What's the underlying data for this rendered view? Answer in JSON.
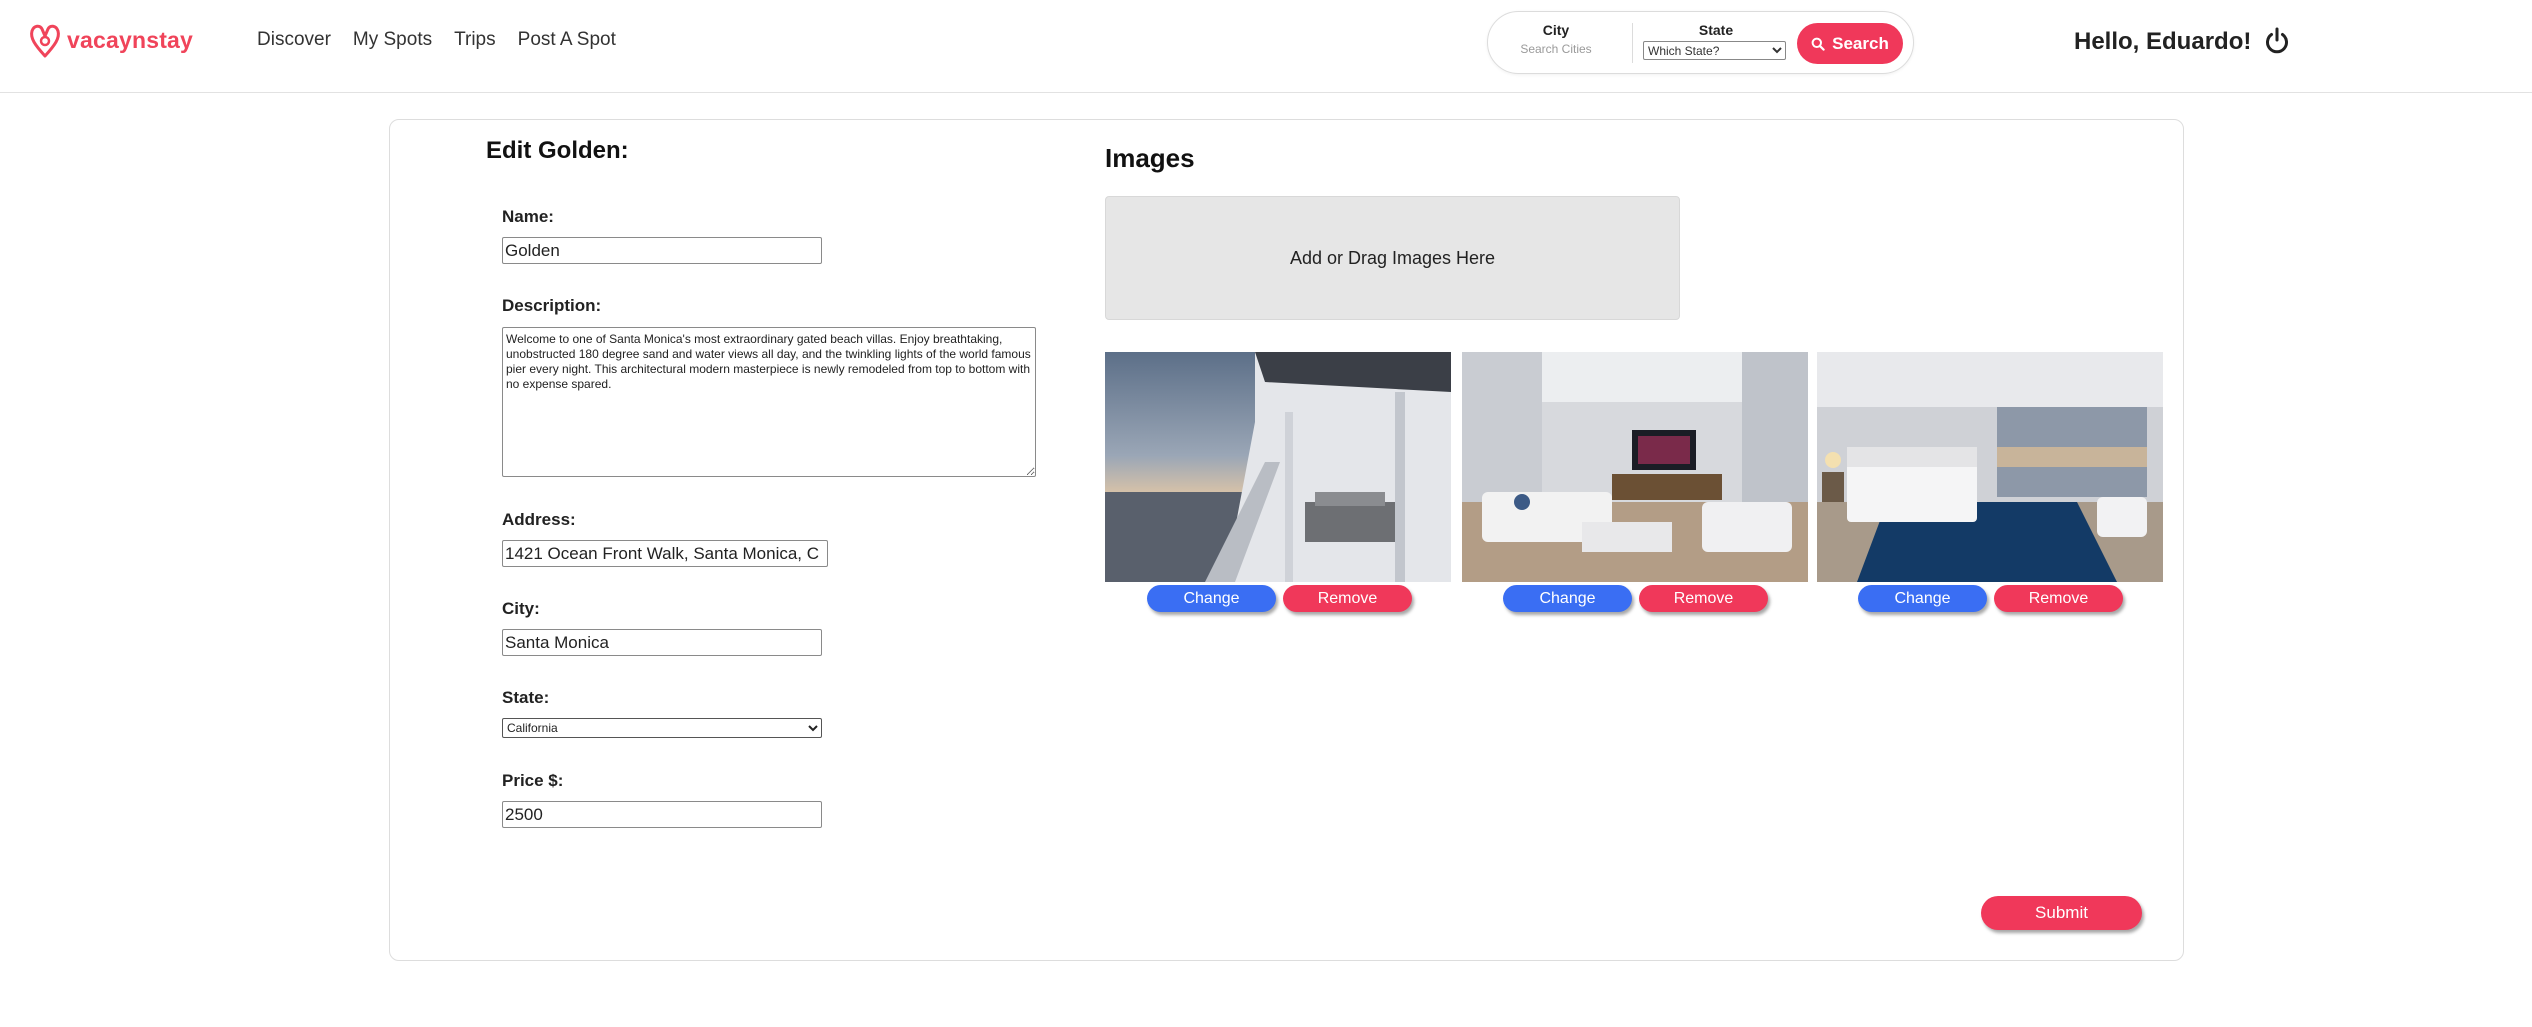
{
  "brand": {
    "name": "vacaynstay",
    "color": "#f0445a",
    "icon": "logo-icon"
  },
  "nav": [
    {
      "label": "Discover"
    },
    {
      "label": "My Spots"
    },
    {
      "label": "Trips"
    },
    {
      "label": "Post A Spot"
    }
  ],
  "search": {
    "city_label": "City",
    "city_placeholder": "Search Cities",
    "state_label": "State",
    "state_selected": "Which State?",
    "button_label": "Search",
    "button_icon": "search-icon",
    "button_color": "#f0385a"
  },
  "user": {
    "greeting": "Hello, Eduardo!",
    "logout_icon": "power-icon"
  },
  "form": {
    "title": "Edit Golden:",
    "name_label": "Name:",
    "name_value": "Golden",
    "description_label": "Description:",
    "description_value": "Welcome to one of Santa Monica's most extraordinary gated beach villas. Enjoy breathtaking, unobstructed 180 degree sand and water views all day, and the twinkling lights of the world famous pier every night. This architectural modern masterpiece is newly remodeled from top to bottom with no expense spared.",
    "address_label": "Address:",
    "address_value": "1421 Ocean Front Walk, Santa Monica, C",
    "city_label": "City:",
    "city_value": "Santa Monica",
    "state_label": "State:",
    "state_selected": "California",
    "price_label": "Price $:",
    "price_value": "2500"
  },
  "images": {
    "title": "Images",
    "dropzone_text": "Add or Drag Images Here",
    "tiles": [
      {
        "change_label": "Change",
        "remove_label": "Remove"
      },
      {
        "change_label": "Change",
        "remove_label": "Remove"
      },
      {
        "change_label": "Change",
        "remove_label": "Remove"
      }
    ],
    "change_color": "#3a6ef3",
    "remove_color": "#f0385a"
  },
  "submit_label": "Submit"
}
